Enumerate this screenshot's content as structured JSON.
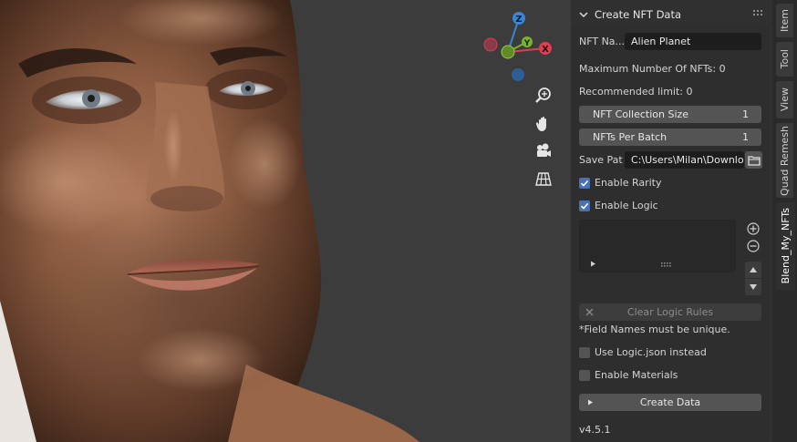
{
  "viewport": {
    "gizmo": {
      "z_label": "Z",
      "y_label": "Y",
      "x_label": "X"
    }
  },
  "panel": {
    "title": "Create NFT Data",
    "nft_name_label": "NFT Na...",
    "nft_name_value": "Alien Planet",
    "max_nfts_text": "Maximum Number Of NFTs: 0",
    "recommended_text": "Recommended limit: 0",
    "collection_size_label": "NFT Collection Size",
    "collection_size_value": "1",
    "per_batch_label": "NFTs Per Batch",
    "per_batch_value": "1",
    "save_path_label": "Save Pat",
    "save_path_value": "C:\\Users\\Milan\\Downlo...",
    "enable_rarity_label": "Enable Rarity",
    "enable_rarity_checked": true,
    "enable_logic_label": "Enable Logic",
    "enable_logic_checked": true,
    "clear_logic_label": "Clear Logic Rules",
    "field_names_note": "*Field Names must be unique.",
    "use_logic_json_label": "Use Logic.json instead",
    "use_logic_json_checked": false,
    "enable_materials_label": "Enable Materials",
    "enable_materials_checked": false,
    "create_data_label": "Create Data",
    "version": "v4.5.1"
  },
  "tabs": [
    {
      "label": "Item",
      "active": false
    },
    {
      "label": "Tool",
      "active": false
    },
    {
      "label": "View",
      "active": false
    },
    {
      "label": "Quad Remesh",
      "active": false
    },
    {
      "label": "Blend_My_NFTs",
      "active": true
    }
  ],
  "colors": {
    "accent": "#4772b3",
    "axis_x": "#e23c51",
    "axis_y": "#7ab32d",
    "axis_z": "#3b86d3"
  }
}
